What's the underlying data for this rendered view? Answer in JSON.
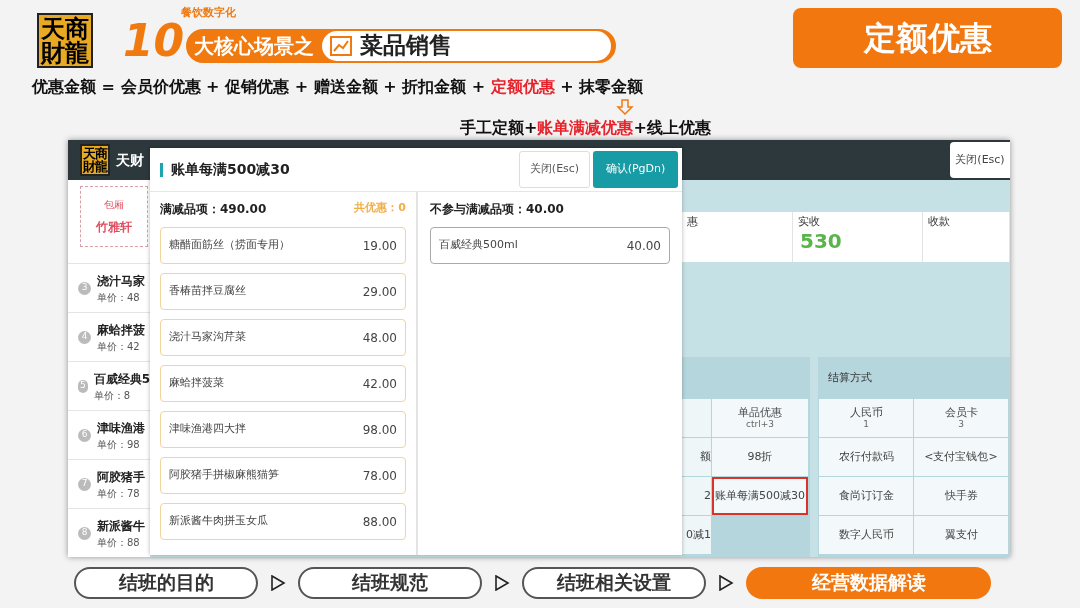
{
  "header": {
    "logo_chars": [
      "天",
      "商",
      "財",
      "龍"
    ],
    "series_number": "10",
    "series_tag": "餐饮数字化",
    "series_title": "大核心场景之",
    "topic": "菜品销售",
    "badge": "定额优惠"
  },
  "formula": {
    "parts": [
      {
        "text": "优惠金额 = 会员价优惠 + 促销优惠 + 赠送金额 + 折扣金额 + ",
        "highlight": false
      },
      {
        "text": "定额优惠",
        "highlight": true
      },
      {
        "text": " + 抹零金额",
        "highlight": false
      }
    ],
    "breakdown": [
      {
        "text": "手工定额+",
        "highlight": false
      },
      {
        "text": "账单满减优惠",
        "highlight": true
      },
      {
        "text": "+线上优惠",
        "highlight": false
      }
    ]
  },
  "app": {
    "logo_chars": [
      "天",
      "商",
      "財",
      "龍"
    ],
    "brand": "天财",
    "close_button": "关闭(Esc)",
    "room": {
      "type": "包厢",
      "name": "竹雅轩"
    },
    "dishes": [
      {
        "index": "3",
        "name": "浇汁马家",
        "price_label": "单价：",
        "price": "48"
      },
      {
        "index": "4",
        "name": "麻蛤拌菠",
        "price_label": "单价：",
        "price": "42"
      },
      {
        "index": "5",
        "name": "百威经典5",
        "price_label": "单价：",
        "price": "8"
      },
      {
        "index": "6",
        "name": "津味渔港",
        "price_label": "单价：",
        "price": "98"
      },
      {
        "index": "7",
        "name": "阿胶猪手",
        "price_label": "单价：",
        "price": "78"
      },
      {
        "index": "8",
        "name": "新派酱牛",
        "price_label": "单价：",
        "price": "88"
      }
    ],
    "summary": [
      {
        "label": "惠"
      },
      {
        "label": "实收",
        "value": "530"
      },
      {
        "label": "收款"
      }
    ],
    "discount_rows": [
      {
        "label": "单品优惠",
        "hint": "ctrl+3",
        "selected": false
      },
      {
        "partial": "额",
        "label": "98折",
        "selected": false
      },
      {
        "partial": "2",
        "label": "账单每满500减30",
        "selected": true
      },
      {
        "partial": "0减1"
      }
    ],
    "payment_title": "结算方式",
    "payments": [
      {
        "label": "人民币",
        "hint": "1"
      },
      {
        "label": "会员卡",
        "hint": "3"
      },
      {
        "label": "农行付款码"
      },
      {
        "label": "<支付宝钱包>"
      },
      {
        "label": "食尚订订金"
      },
      {
        "label": "快手券"
      },
      {
        "label": "数字人民币"
      },
      {
        "label": "翼支付"
      }
    ]
  },
  "modal": {
    "title": "账单每满500减30",
    "close_button": "关闭(Esc)",
    "confirm_button": "确认(PgDn)",
    "included": {
      "label": "满减品项：490.00",
      "total": "共优惠：0",
      "items": [
        {
          "name": "糖醋面筋丝（捞面专用）",
          "price": "19.00"
        },
        {
          "name": "香椿苗拌豆腐丝",
          "price": "29.00"
        },
        {
          "name": "浇汁马家沟芹菜",
          "price": "48.00"
        },
        {
          "name": "麻蛤拌菠菜",
          "price": "42.00"
        },
        {
          "name": "津味渔港四大拌",
          "price": "98.00"
        },
        {
          "name": "阿胶猪手拼椒麻熊猫笋",
          "price": "78.00"
        },
        {
          "name": "新派酱牛肉拼玉女瓜",
          "price": "88.00"
        }
      ]
    },
    "excluded": {
      "label": "不参与满减品项：40.00",
      "items": [
        {
          "name": "百威经典500ml",
          "price": "40.00"
        }
      ]
    }
  },
  "steps": [
    {
      "label": "结班的目的",
      "selected": false
    },
    {
      "label": "结班规范",
      "selected": false
    },
    {
      "label": "结班相关设置",
      "selected": false
    },
    {
      "label": "经营数据解读",
      "selected": true
    }
  ]
}
